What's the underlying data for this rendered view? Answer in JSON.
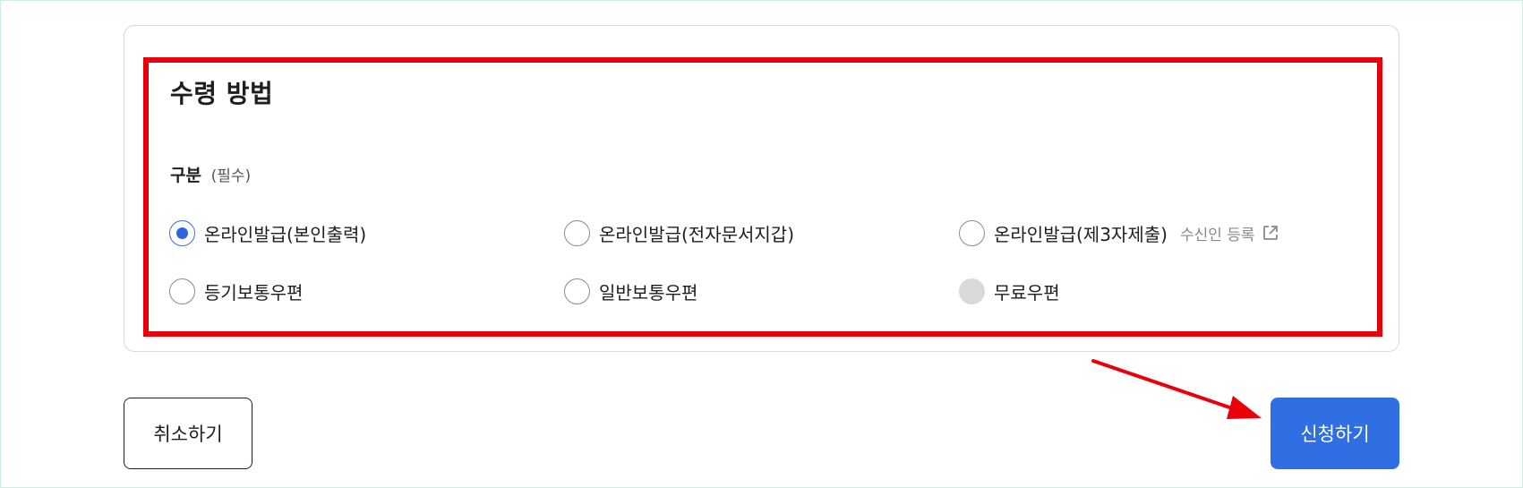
{
  "section": {
    "title": "수령 방법",
    "field_label": "구분",
    "required_text": "(필수)"
  },
  "options": [
    {
      "label": "온라인발급(본인출력)",
      "selected": true,
      "disabled": false
    },
    {
      "label": "온라인발급(전자문서지갑)",
      "selected": false,
      "disabled": false
    },
    {
      "label": "온라인발급(제3자제출)",
      "selected": false,
      "disabled": false
    },
    {
      "label": "등기보통우편",
      "selected": false,
      "disabled": false
    },
    {
      "label": "일반보통우편",
      "selected": false,
      "disabled": false
    },
    {
      "label": "무료우편",
      "selected": false,
      "disabled": true
    }
  ],
  "recipient_link": {
    "label": "수신인 등록",
    "icon": "external-link-icon"
  },
  "buttons": {
    "cancel_label": "취소하기",
    "submit_label": "신청하기"
  },
  "colors": {
    "highlight": "#e8000b",
    "accent": "#2f6fe3",
    "annotation_arrow": "#e8000b"
  }
}
